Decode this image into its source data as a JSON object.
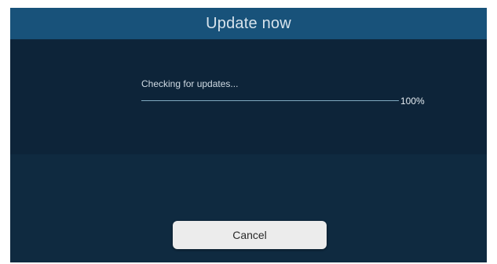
{
  "dialog": {
    "title": "Update now",
    "status_text": "Checking for updates...",
    "progress": {
      "percent": 100,
      "label": "100%"
    },
    "cancel_label": "Cancel"
  },
  "colors": {
    "title_bar": "#18527a",
    "background": "#0f2a40",
    "content_panel": "#0d2439",
    "button": "#ececec"
  }
}
